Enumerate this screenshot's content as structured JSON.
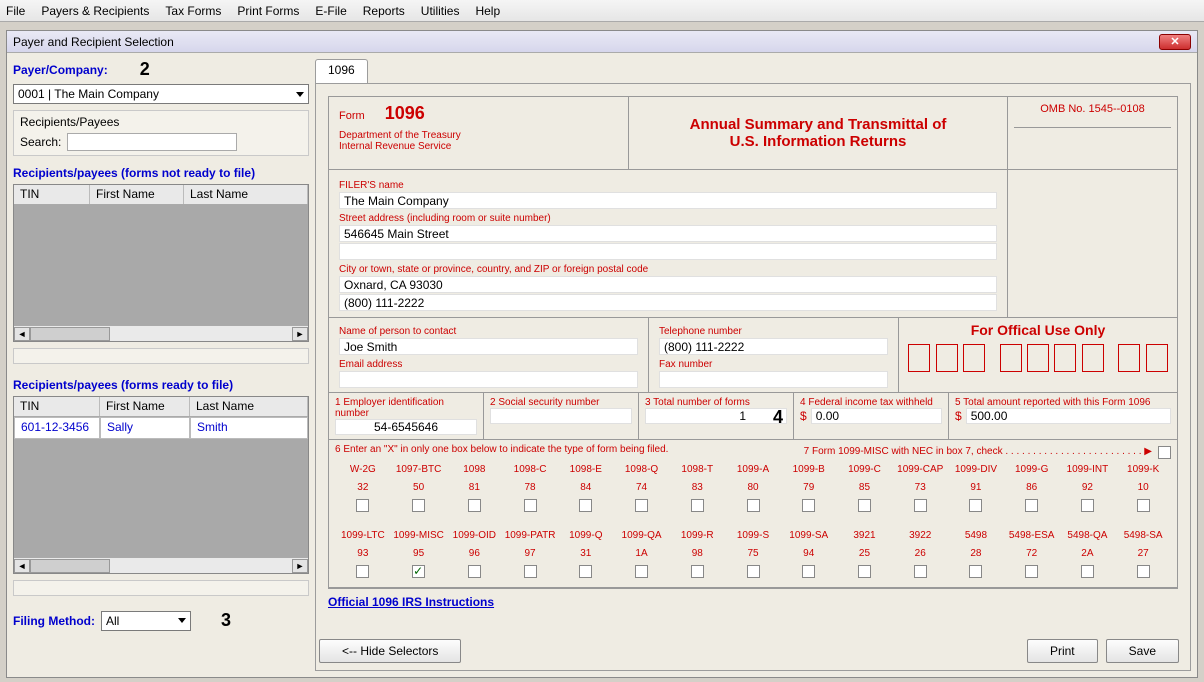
{
  "menu": {
    "file": "File",
    "payers": "Payers & Recipients",
    "taxforms": "Tax Forms",
    "printforms": "Print Forms",
    "efile": "E-File",
    "reports": "Reports",
    "utilities": "Utilities",
    "help": "Help"
  },
  "window": {
    "title": "Payer and Recipient Selection"
  },
  "left": {
    "payercompany_label": "Payer/Company:",
    "payercompany_value": "0001 | The Main Company",
    "recipients_panel": "Recipients/Payees",
    "search_label": "Search:",
    "not_ready_label": "Recipients/payees (forms not ready to file)",
    "ready_label": "Recipients/payees (forms ready to file)",
    "cols": {
      "tin": "TIN",
      "first": "First Name",
      "last": "Last Name"
    },
    "ready_rows": [
      {
        "tin": "601-12-3456",
        "first": "Sally",
        "last": "Smith"
      }
    ],
    "filing_method_label": "Filing Method:",
    "filing_method_value": "All",
    "step2": "2",
    "step3": "3"
  },
  "tabs": {
    "t1096": "1096"
  },
  "form": {
    "form_label": "Form",
    "form_num": "1096",
    "dept": "Department of the Treasury",
    "irs": "Internal Revenue Service",
    "title1": "Annual Summary and Transmittal of",
    "title2": "U.S. Information Returns",
    "omb": "OMB No. 1545--0108",
    "filers_name_label": "FILER'S name",
    "filers_name": "The Main Company",
    "street_label": "Street address (including room or suite number)",
    "street": "546645 Main Street",
    "city_label": "City or town, state or province, country, and ZIP or foreign postal code",
    "city": "Oxnard, CA 93030",
    "phone": "(800) 111-2222",
    "contact_name_label": "Name of person to contact",
    "contact_name": "Joe Smith",
    "telephone_label": "Telephone number",
    "telephone": "(800) 111-2222",
    "email_label": "Email address",
    "fax_label": "Fax number",
    "official_use": "For Offical Use Only",
    "box1_label": "1  Employer identification number",
    "box1": "54-6545646",
    "box2_label": "2  Social security number",
    "box2": "",
    "box3_label": "3  Total number of forms",
    "box3": "1",
    "step4": "4",
    "box4_label": "4  Federal income tax withheld",
    "box4": "0.00",
    "box5_label": "5 Total amount reported with this Form 1096",
    "box5": "500.00",
    "box6_label": "6 Enter an \"X\" in only one box below to indicate the type of form being filed.",
    "box7_label": "7 Form 1099-MISC with NEC in box 7, check . . . . . . . . . . . . . . . . . . . . . . . . . ▶",
    "dollar": "$",
    "types_row1": [
      {
        "lbl": "W-2G",
        "code": "32",
        "checked": false
      },
      {
        "lbl": "1097-BTC",
        "code": "50",
        "checked": false
      },
      {
        "lbl": "1098",
        "code": "81",
        "checked": false
      },
      {
        "lbl": "1098-C",
        "code": "78",
        "checked": false
      },
      {
        "lbl": "1098-E",
        "code": "84",
        "checked": false
      },
      {
        "lbl": "1098-Q",
        "code": "74",
        "checked": false
      },
      {
        "lbl": "1098-T",
        "code": "83",
        "checked": false
      },
      {
        "lbl": "1099-A",
        "code": "80",
        "checked": false
      },
      {
        "lbl": "1099-B",
        "code": "79",
        "checked": false
      },
      {
        "lbl": "1099-C",
        "code": "85",
        "checked": false
      },
      {
        "lbl": "1099-CAP",
        "code": "73",
        "checked": false
      },
      {
        "lbl": "1099-DIV",
        "code": "91",
        "checked": false
      },
      {
        "lbl": "1099-G",
        "code": "86",
        "checked": false
      },
      {
        "lbl": "1099-INT",
        "code": "92",
        "checked": false
      },
      {
        "lbl": "1099-K",
        "code": "10",
        "checked": false
      }
    ],
    "types_row2": [
      {
        "lbl": "1099-LTC",
        "code": "93",
        "checked": false
      },
      {
        "lbl": "1099-MISC",
        "code": "95",
        "checked": true
      },
      {
        "lbl": "1099-OID",
        "code": "96",
        "checked": false
      },
      {
        "lbl": "1099-PATR",
        "code": "97",
        "checked": false
      },
      {
        "lbl": "1099-Q",
        "code": "31",
        "checked": false
      },
      {
        "lbl": "1099-QA",
        "code": "1A",
        "checked": false
      },
      {
        "lbl": "1099-R",
        "code": "98",
        "checked": false
      },
      {
        "lbl": "1099-S",
        "code": "75",
        "checked": false
      },
      {
        "lbl": "1099-SA",
        "code": "94",
        "checked": false
      },
      {
        "lbl": "3921",
        "code": "25",
        "checked": false
      },
      {
        "lbl": "3922",
        "code": "26",
        "checked": false
      },
      {
        "lbl": "5498",
        "code": "28",
        "checked": false
      },
      {
        "lbl": "5498-ESA",
        "code": "72",
        "checked": false
      },
      {
        "lbl": "5498-QA",
        "code": "2A",
        "checked": false
      },
      {
        "lbl": "5498-SA",
        "code": "27",
        "checked": false
      }
    ],
    "instructions_link": "Official 1096  IRS Instructions"
  },
  "buttons": {
    "hide": "<-- Hide Selectors",
    "print": "Print",
    "save": "Save"
  }
}
